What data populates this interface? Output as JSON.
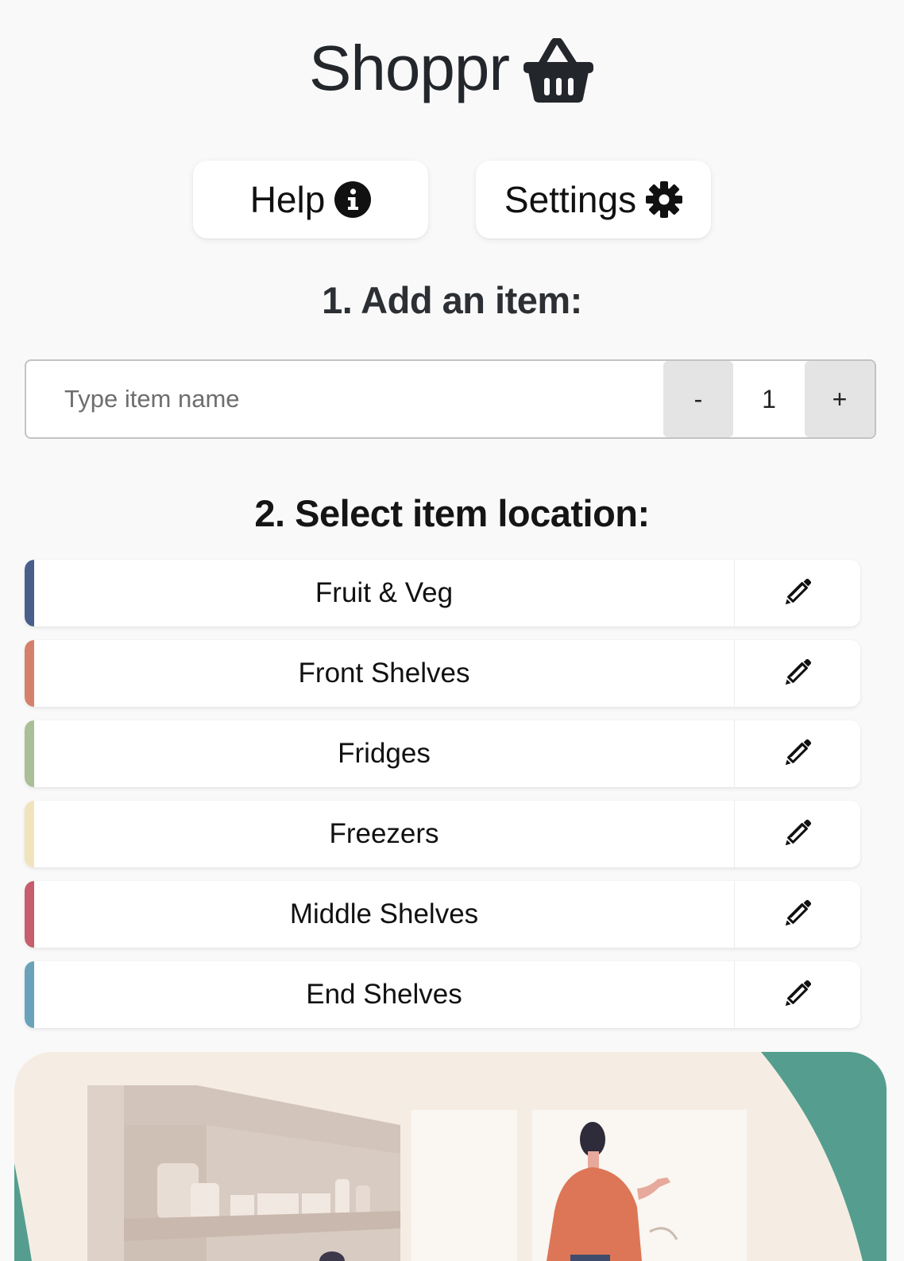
{
  "app": {
    "title": "Shoppr",
    "title_icon": "basket-icon"
  },
  "toolbar": {
    "help_label": "Help",
    "help_icon": "info-circle-icon",
    "settings_label": "Settings",
    "settings_icon": "gear-icon"
  },
  "add_item": {
    "heading": "1. Add an item:",
    "placeholder": "Type item name",
    "value": "",
    "decrement_label": "-",
    "quantity": "1",
    "increment_label": "+"
  },
  "locations": {
    "heading": "2. Select item location:",
    "edit_icon": "pencil-icon",
    "items": [
      {
        "label": "Fruit & Veg",
        "color": "#4a5e8c"
      },
      {
        "label": "Front Shelves",
        "color": "#d4806a"
      },
      {
        "label": "Fridges",
        "color": "#a9bf95"
      },
      {
        "label": "Freezers",
        "color": "#f1e4bd"
      },
      {
        "label": "Middle Shelves",
        "color": "#c75d6d"
      },
      {
        "label": "End Shelves",
        "color": "#6aa2bb"
      }
    ]
  },
  "illustration": {
    "background_color": "#f5ede3",
    "accent_color": "#559e8f"
  }
}
